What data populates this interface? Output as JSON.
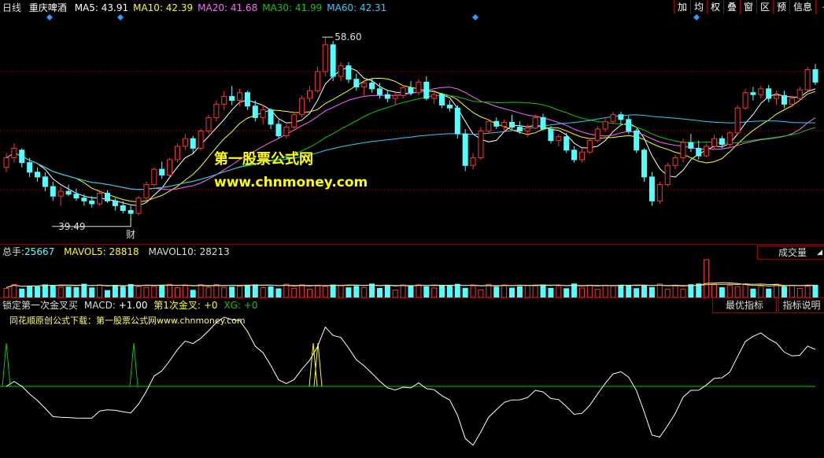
{
  "header": {
    "period": "日线",
    "stock_name": "重庆啤酒",
    "ma": [
      {
        "label": "MA5:",
        "value": "43.91",
        "color": "#ffffff"
      },
      {
        "label": "MA10:",
        "value": "42.39",
        "color": "#ffff00"
      },
      {
        "label": "MA20:",
        "value": "41.68",
        "color": "#ff66ff"
      },
      {
        "label": "MA30:",
        "value": "41.99",
        "color": "#00cc00"
      },
      {
        "label": "MA60:",
        "value": "42.31",
        "color": "#33ccff"
      }
    ],
    "toolbar": [
      "加",
      "均",
      "权",
      "叠",
      "窗",
      "区",
      "预",
      "信息",
      "⇥"
    ]
  },
  "price_chart": {
    "high_label": "58.60",
    "low_label": "39.49",
    "finance_marker": "财",
    "watermark_title": "第一股票公式网",
    "watermark_url": "www.chnmoney.com",
    "candles": [
      [
        45,
        46.5,
        44.5,
        46
      ],
      [
        46,
        47.5,
        45.5,
        47
      ],
      [
        46.8,
        47,
        45,
        45.5
      ],
      [
        45.5,
        46,
        44,
        44.5
      ],
      [
        44.5,
        45,
        43.5,
        44
      ],
      [
        44,
        44.5,
        42.5,
        43
      ],
      [
        43,
        43.5,
        41.5,
        42
      ],
      [
        42,
        43,
        41,
        42.5
      ],
      [
        42.5,
        43.2,
        42,
        42.2
      ],
      [
        42.2,
        42.8,
        41.5,
        41.8
      ],
      [
        41.8,
        42.2,
        41,
        41.5
      ],
      [
        41.5,
        42,
        40.8,
        41.2
      ],
      [
        41.2,
        42.5,
        41,
        42.3
      ],
      [
        42.3,
        42.6,
        41.3,
        41.5
      ],
      [
        41.5,
        41.8,
        40.5,
        41
      ],
      [
        41,
        41.5,
        40.2,
        40.5
      ],
      [
        40.5,
        41,
        39.49,
        40.2
      ],
      [
        40.2,
        42,
        40,
        41.8
      ],
      [
        41.8,
        43.5,
        41.5,
        43.2
      ],
      [
        43.2,
        45,
        43,
        44.8
      ],
      [
        44.8,
        45.6,
        43.8,
        44.2
      ],
      [
        44.2,
        46,
        44,
        45.8
      ],
      [
        45.8,
        47.5,
        45.5,
        47.2
      ],
      [
        47.2,
        48.5,
        46.8,
        48
      ],
      [
        48,
        48.3,
        46.5,
        47
      ],
      [
        47,
        49,
        46.8,
        48.8
      ],
      [
        48.8,
        50.5,
        48.5,
        50.2
      ],
      [
        50.2,
        52,
        49.8,
        51.6
      ],
      [
        51.6,
        53,
        51,
        52.4
      ],
      [
        52.4,
        53.5,
        51.5,
        52
      ],
      [
        52,
        53.2,
        51.4,
        52.8
      ],
      [
        52.8,
        53,
        51,
        51.4
      ],
      [
        51.4,
        52,
        49.8,
        50.2
      ],
      [
        50.2,
        51.5,
        49.5,
        51
      ],
      [
        51,
        51.2,
        49,
        49.5
      ],
      [
        49.5,
        50,
        48,
        48.3
      ],
      [
        48.3,
        49.5,
        48,
        49.2
      ],
      [
        49.2,
        50.8,
        49,
        50.5
      ],
      [
        50.5,
        52.5,
        50.2,
        52.2
      ],
      [
        52.2,
        53.5,
        51.8,
        53
      ],
      [
        53,
        55.5,
        52.8,
        55
      ],
      [
        55,
        58.6,
        54.5,
        57.8
      ],
      [
        57.8,
        58.2,
        54,
        54.5
      ],
      [
        54.5,
        56,
        54,
        55.6
      ],
      [
        55.6,
        56,
        53.8,
        54.2
      ],
      [
        54.2,
        54.8,
        53,
        53.4
      ],
      [
        53.4,
        54,
        52.5,
        53.8
      ],
      [
        53.8,
        54.3,
        52.8,
        53.2
      ],
      [
        53.2,
        53.8,
        52.2,
        52.6
      ],
      [
        52.6,
        53,
        51.8,
        52.2
      ],
      [
        52.2,
        52.8,
        51.5,
        52.5
      ],
      [
        52.5,
        53.6,
        52.2,
        53.3
      ],
      [
        53.3,
        54,
        52.5,
        52.8
      ],
      [
        52.8,
        54.2,
        52.5,
        53.9
      ],
      [
        53.9,
        54.5,
        52,
        52.2
      ],
      [
        52.2,
        53,
        51.6,
        52.6
      ],
      [
        52.6,
        52.8,
        51.2,
        51.5
      ],
      [
        51.5,
        52,
        50.8,
        51.2
      ],
      [
        51.2,
        51.5,
        48,
        48.5
      ],
      [
        48.5,
        49,
        44.6,
        45.2
      ],
      [
        45.2,
        46.5,
        44.8,
        46
      ],
      [
        46,
        49.2,
        45.8,
        48.8
      ],
      [
        48.8,
        50,
        48.5,
        49.8
      ],
      [
        49.8,
        50.2,
        49,
        49.3
      ],
      [
        49.3,
        50,
        48.8,
        49.7
      ],
      [
        49.7,
        50.5,
        49,
        49.2
      ],
      [
        49.2,
        49.8,
        48.5,
        48.8
      ],
      [
        48.8,
        49.5,
        48.2,
        49.1
      ],
      [
        49.1,
        50.5,
        49,
        50.2
      ],
      [
        50.2,
        50.6,
        48.8,
        49
      ],
      [
        49,
        49.3,
        47.5,
        47.8
      ],
      [
        47.8,
        48.5,
        47.2,
        48.2
      ],
      [
        48.2,
        48.6,
        46.5,
        46.8
      ],
      [
        46.8,
        47.2,
        45.5,
        45.8
      ],
      [
        45.8,
        47,
        45.5,
        46.6
      ],
      [
        46.6,
        48,
        46.4,
        47.8
      ],
      [
        47.8,
        49.3,
        47.6,
        49
      ],
      [
        49,
        50.2,
        48.7,
        49.8
      ],
      [
        49.8,
        50.8,
        49.5,
        50.5
      ],
      [
        50.5,
        50.8,
        49.5,
        50
      ],
      [
        50,
        50.4,
        48.5,
        48.8
      ],
      [
        48.8,
        49,
        46.5,
        46.8
      ],
      [
        46.8,
        47,
        43.5,
        44
      ],
      [
        44,
        44.5,
        41,
        41.5
      ],
      [
        41.5,
        43.5,
        41.2,
        43.2
      ],
      [
        43.2,
        45.5,
        43,
        45.2
      ],
      [
        45.2,
        46.3,
        44.8,
        46
      ],
      [
        46,
        48,
        45.5,
        47.6
      ],
      [
        47.6,
        48.5,
        46.6,
        47
      ],
      [
        47,
        47.8,
        45.8,
        46.2
      ],
      [
        46.2,
        47.5,
        46,
        47.2
      ],
      [
        47.2,
        48.4,
        46.8,
        48
      ],
      [
        48,
        48.3,
        47,
        47.4
      ],
      [
        47.4,
        48.8,
        47,
        48.6
      ],
      [
        48.6,
        51.5,
        48.4,
        51.2
      ],
      [
        51.2,
        53.2,
        51,
        52.8
      ],
      [
        52.8,
        53.4,
        52,
        52.6
      ],
      [
        52.6,
        53.5,
        52.2,
        53.2
      ],
      [
        53.2,
        53.6,
        51.8,
        52.2
      ],
      [
        52.2,
        53,
        51.5,
        52.5
      ],
      [
        52.5,
        53,
        51.2,
        51.6
      ],
      [
        51.6,
        52.5,
        51.3,
        52.2
      ],
      [
        52.2,
        53.4,
        52,
        53.1
      ],
      [
        53.1,
        55.5,
        53,
        55.2
      ],
      [
        55.2,
        55.8,
        53.6,
        53.9
      ]
    ]
  },
  "volume_panel": {
    "total_label": "总手:",
    "total_value": "25667",
    "mavol5_label": "MAVOL5:",
    "mavol5_value": "28818",
    "mavol10_label": "MAVOL10:",
    "mavol10_value": "28213",
    "dropdown": "成交量"
  },
  "indicator_panel": {
    "name": "锁定第一次金叉买",
    "macd_label": "MACD:",
    "macd_value": "+1.00",
    "first_cross_label": "第1次金叉:",
    "first_cross_value": "+0",
    "xg_label": "XG:",
    "xg_value": "+0",
    "button_best": "最优指标",
    "button_help": "指标说明",
    "credit": "同花顺原创公式下载：第一股票公式网www.chnmoney.com"
  },
  "colors": {
    "up": "#ff3333",
    "down": "#54ffff",
    "grid": "#a00000",
    "panel_border": "#a00000",
    "marker": "#3399ff"
  }
}
